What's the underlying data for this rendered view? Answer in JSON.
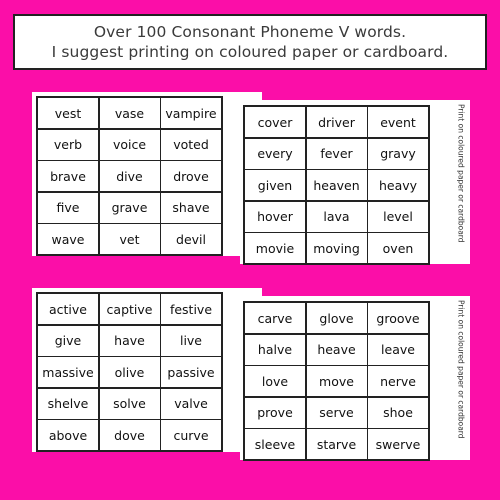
{
  "header": {
    "line1": "Over 100 Consonant Phoneme V words.",
    "line2": "I suggest printing on coloured paper or cardboard."
  },
  "colors": {
    "background": "#fb0ea8",
    "card": "#ffffff",
    "border": "#222222"
  },
  "cards": [
    {
      "words": [
        "vest",
        "vase",
        "vampire",
        "verb",
        "voice",
        "voted",
        "brave",
        "dive",
        "drove",
        "five",
        "grave",
        "shave",
        "wave",
        "vet",
        "devil"
      ],
      "side_note": ""
    },
    {
      "words": [
        "cover",
        "driver",
        "event",
        "every",
        "fever",
        "gravy",
        "given",
        "heaven",
        "heavy",
        "hover",
        "lava",
        "level",
        "movie",
        "moving",
        "oven"
      ],
      "side_note": "Print on coloured paper or cardboard"
    },
    {
      "words": [
        "active",
        "captive",
        "festive",
        "give",
        "have",
        "live",
        "massive",
        "olive",
        "passive",
        "shelve",
        "solve",
        "valve",
        "above",
        "dove",
        "curve"
      ],
      "side_note": ""
    },
    {
      "words": [
        "carve",
        "glove",
        "groove",
        "halve",
        "heave",
        "leave",
        "love",
        "move",
        "nerve",
        "prove",
        "serve",
        "shoe",
        "sleeve",
        "starve",
        "swerve"
      ],
      "side_note": "Print on coloured paper or cardboard"
    }
  ]
}
